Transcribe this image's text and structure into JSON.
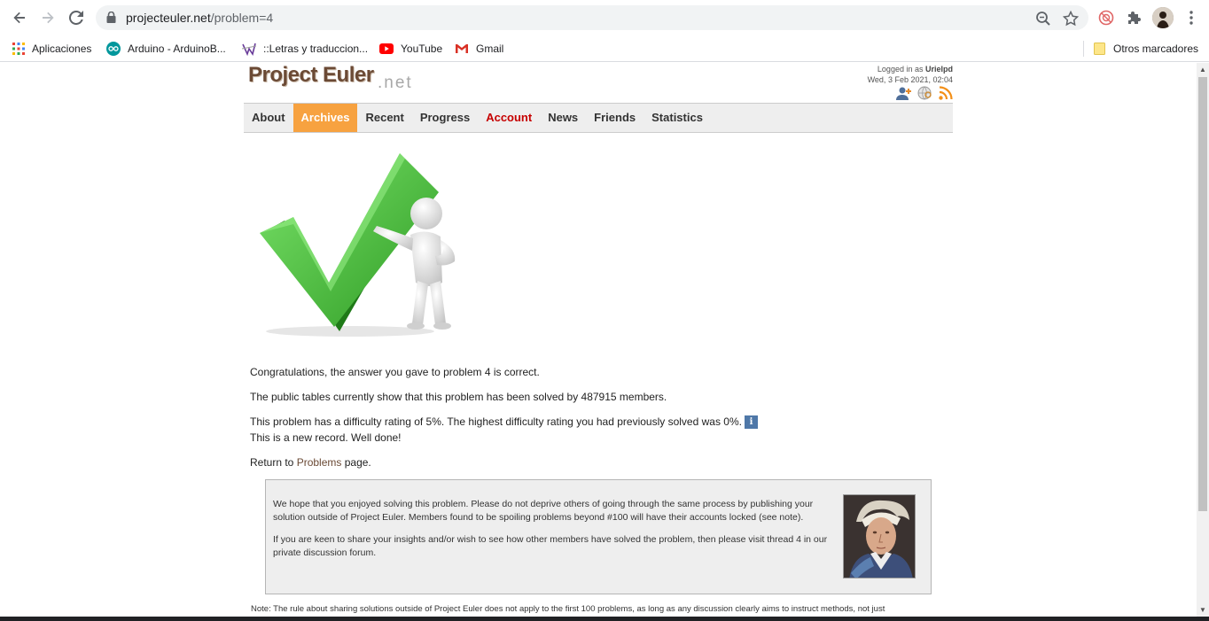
{
  "browser": {
    "url_host": "projecteuler.net",
    "url_path": "/problem=4",
    "bookmarks": [
      {
        "label": "Aplicaciones",
        "icon": "apps-grid-icon"
      },
      {
        "label": "Arduino - ArduinoB...",
        "icon": "arduino-icon"
      },
      {
        "label": "::Letras y traduccion...",
        "icon": "letras-icon"
      },
      {
        "label": "YouTube",
        "icon": "youtube-icon"
      },
      {
        "label": "Gmail",
        "icon": "gmail-icon"
      }
    ],
    "other_bookmarks": "Otros marcadores"
  },
  "site": {
    "logo_main": "Project Euler",
    "logo_net": ".net",
    "login_prefix": "Logged in as",
    "username": "Urielpd",
    "datetime": "Wed, 3 Feb 2021, 02:04"
  },
  "menu": [
    {
      "label": "About",
      "state": "normal"
    },
    {
      "label": "Archives",
      "state": "active"
    },
    {
      "label": "Recent",
      "state": "normal"
    },
    {
      "label": "Progress",
      "state": "normal"
    },
    {
      "label": "Account",
      "state": "red"
    },
    {
      "label": "News",
      "state": "normal"
    },
    {
      "label": "Friends",
      "state": "normal"
    },
    {
      "label": "Statistics",
      "state": "normal"
    }
  ],
  "content": {
    "congrats": "Congratulations, the answer you gave to problem 4 is correct.",
    "solved_by": "The public tables currently show that this problem has been solved by 487915 members.",
    "difficulty": "This problem has a difficulty rating of 5%. The highest difficulty rating you had previously solved was 0%.",
    "info_glyph": "i",
    "record": "This is a new record. Well done!",
    "return_prefix": "Return to",
    "return_link": "Problems",
    "return_suffix": "page."
  },
  "notice": {
    "para1": "We hope that you enjoyed solving this problem. Please do not deprive others of going through the same process by publishing your solution outside of Project Euler. Members found to be spoiling problems beyond #100 will have their accounts locked (see note).",
    "para2": "If you are keen to share your insights and/or wish to see how other members have solved the problem, then please visit thread 4 in our private discussion forum."
  },
  "footnote": "Note: The rule about sharing solutions outside of Project Euler does not apply to the first 100 problems, as long as any discussion clearly aims to instruct methods, not just",
  "colors": {
    "menu_active": "#f7a240",
    "menu_red": "#c60000",
    "logo": "#6b4a35"
  }
}
